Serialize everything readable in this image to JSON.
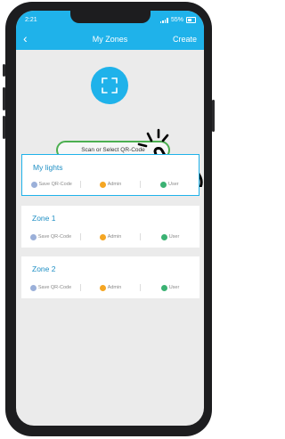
{
  "status_bar": {
    "time": "2:21",
    "battery_text": "55%"
  },
  "navbar": {
    "back_glyph": "‹",
    "title": "My Zones",
    "create_label": "Create"
  },
  "scan": {
    "button_label": "Scan or Select QR-Code"
  },
  "zones": [
    {
      "name": "My lights",
      "selected": true
    },
    {
      "name": "Zone 1",
      "selected": false
    },
    {
      "name": "Zone 2",
      "selected": false
    }
  ],
  "zone_actions": {
    "save": "Save QR-Code",
    "admin": "Admin",
    "user": "User"
  },
  "colors": {
    "accent": "#1fb2ea",
    "scan_border": "#4caf50",
    "admin_badge": "#f5a623",
    "user_badge": "#3bb273"
  },
  "icons": [
    "back-chevron-icon",
    "signal-icon",
    "battery-icon",
    "qr-scan-icon",
    "tapping-hand-icon",
    "save-qr-icon",
    "admin-icon",
    "user-icon"
  ]
}
